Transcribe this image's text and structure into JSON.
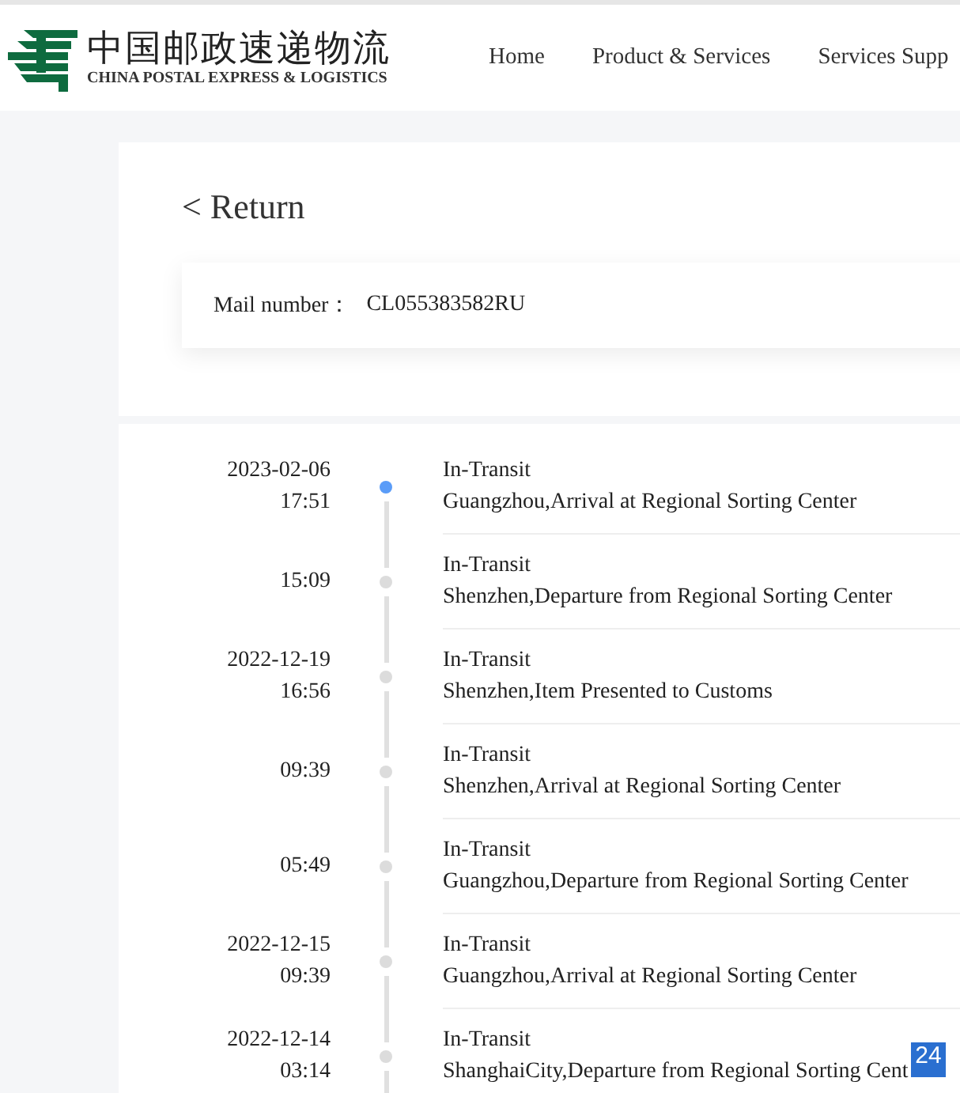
{
  "header": {
    "logo": {
      "name_cn": "中国邮政速递物流",
      "name_en": "CHINA POSTAL EXPRESS & LOGISTICS"
    },
    "nav": [
      {
        "label": "Home"
      },
      {
        "label": "Product & Services"
      },
      {
        "label": "Services Supp"
      }
    ]
  },
  "return_link": "< Return",
  "mail": {
    "label": "Mail number：",
    "value": "CL055383582RU"
  },
  "events": [
    {
      "date": "2023-02-06",
      "time": "17:51",
      "status": "In-Transit",
      "description": "Guangzhou,Arrival at Regional Sorting Center",
      "current": true
    },
    {
      "time": "15:09",
      "status": "In-Transit",
      "description": "Shenzhen,Departure from Regional Sorting Center",
      "current": false
    },
    {
      "date": "2022-12-19",
      "time": "16:56",
      "status": "In-Transit",
      "description": "Shenzhen,Item Presented to Customs",
      "current": false
    },
    {
      "time": "09:39",
      "status": "In-Transit",
      "description": "Shenzhen,Arrival at Regional Sorting Center",
      "current": false
    },
    {
      "time": "05:49",
      "status": "In-Transit",
      "description": "Guangzhou,Departure from Regional Sorting Center",
      "current": false
    },
    {
      "date": "2022-12-15",
      "time": "09:39",
      "status": "In-Transit",
      "description": "Guangzhou,Arrival at Regional Sorting Center",
      "current": false
    },
    {
      "date": "2022-12-14",
      "time": "03:14",
      "status": "In-Transit",
      "description": "ShanghaiCity,Departure from Regional Sorting Cent",
      "current": false
    }
  ],
  "corner_badge": "24"
}
